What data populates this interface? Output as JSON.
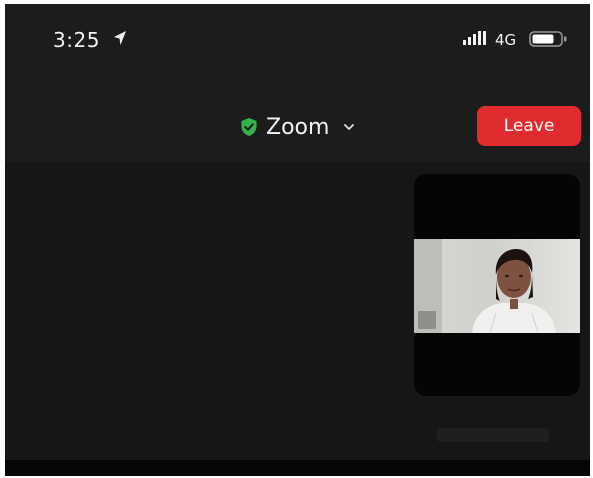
{
  "status_bar": {
    "time": "3:25",
    "network": "4G",
    "icons": [
      "location-arrow-icon",
      "signal-bars-icon",
      "battery-icon"
    ]
  },
  "header": {
    "meeting_title": "Zoom",
    "leave_label": "Leave",
    "icons": [
      "shield-check-icon",
      "chevron-down-icon"
    ]
  },
  "colors": {
    "background": "#1c1c1c",
    "leave_button": "#e02b2f",
    "shield": "#35b34a",
    "thumbnail": "#050505"
  }
}
